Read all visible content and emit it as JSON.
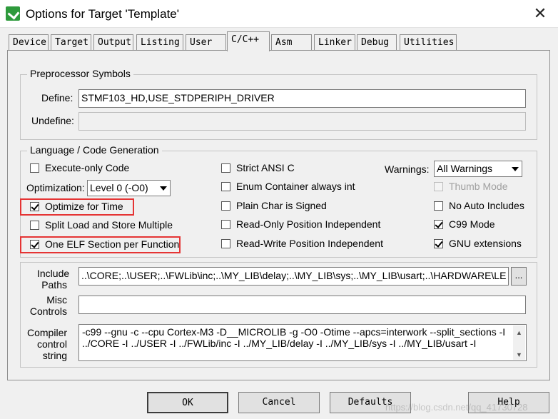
{
  "window": {
    "title": "Options for Target 'Template'",
    "close_glyph": "✕"
  },
  "tabs": [
    {
      "label": "Device"
    },
    {
      "label": "Target"
    },
    {
      "label": "Output"
    },
    {
      "label": "Listing"
    },
    {
      "label": "User"
    },
    {
      "label": "C/C++"
    },
    {
      "label": "Asm"
    },
    {
      "label": "Linker"
    },
    {
      "label": "Debug"
    },
    {
      "label": "Utilities"
    }
  ],
  "preprocessor": {
    "title": "Preprocessor Symbols",
    "define_label": "Define:",
    "define_value": "STMF103_HD,USE_STDPERIPH_DRIVER",
    "undefine_label": "Undefine:",
    "undefine_value": ""
  },
  "language": {
    "title": "Language / Code Generation",
    "execute_only": {
      "label": "Execute-only Code",
      "checked": false
    },
    "optimization_label": "Optimization:",
    "optimization_value": "Level 0 (-O0)",
    "optimize_time": {
      "label": "Optimize for Time",
      "checked": true
    },
    "split_load": {
      "label": "Split Load and Store Multiple",
      "checked": false
    },
    "one_elf": {
      "label": "One ELF Section per Function",
      "checked": true
    },
    "strict_ansi": {
      "label": "Strict ANSI C",
      "checked": false
    },
    "enum_container": {
      "label": "Enum Container always int",
      "checked": false
    },
    "plain_char": {
      "label": "Plain Char is Signed",
      "checked": false
    },
    "ro_pi": {
      "label": "Read-Only Position Independent",
      "checked": false
    },
    "rw_pi": {
      "label": "Read-Write Position Independent",
      "checked": false
    },
    "warnings_label": "Warnings:",
    "warnings_value": "All Warnings",
    "thumb_mode": {
      "label": "Thumb Mode",
      "checked": false,
      "disabled": true
    },
    "no_auto_includes": {
      "label": "No Auto Includes",
      "checked": false
    },
    "c99_mode": {
      "label": "C99 Mode",
      "checked": true
    },
    "gnu_extensions": {
      "label": "GNU extensions",
      "checked": true
    }
  },
  "include_paths": {
    "label_line1": "Include",
    "label_line2": "Paths",
    "value": "..\\CORE;..\\USER;..\\FWLib\\inc;..\\MY_LIB\\delay;..\\MY_LIB\\sys;..\\MY_LIB\\usart;..\\HARDWARE\\LE",
    "browse_label": "..."
  },
  "misc_controls": {
    "label_line1": "Misc",
    "label_line2": "Controls",
    "value": ""
  },
  "compiler_string": {
    "label_line1": "Compiler",
    "label_line2": "control",
    "label_line3": "string",
    "line1": "-c99 --gnu -c --cpu Cortex-M3 -D__MICROLIB -g -O0 -Otime --apcs=interwork --split_sections -I",
    "line2": "../CORE -I ../USER -I ../FWLib/inc -I ../MY_LIB/delay -I ../MY_LIB/sys -I ../MY_LIB/usart -I"
  },
  "buttons": {
    "ok": "OK",
    "cancel": "Cancel",
    "defaults": "Defaults",
    "help": "Help"
  },
  "watermark": "https://blog.csdn.net/qq_41730728",
  "colors": {
    "highlight": "#e53434",
    "app_icon": "#2e9a3c"
  }
}
